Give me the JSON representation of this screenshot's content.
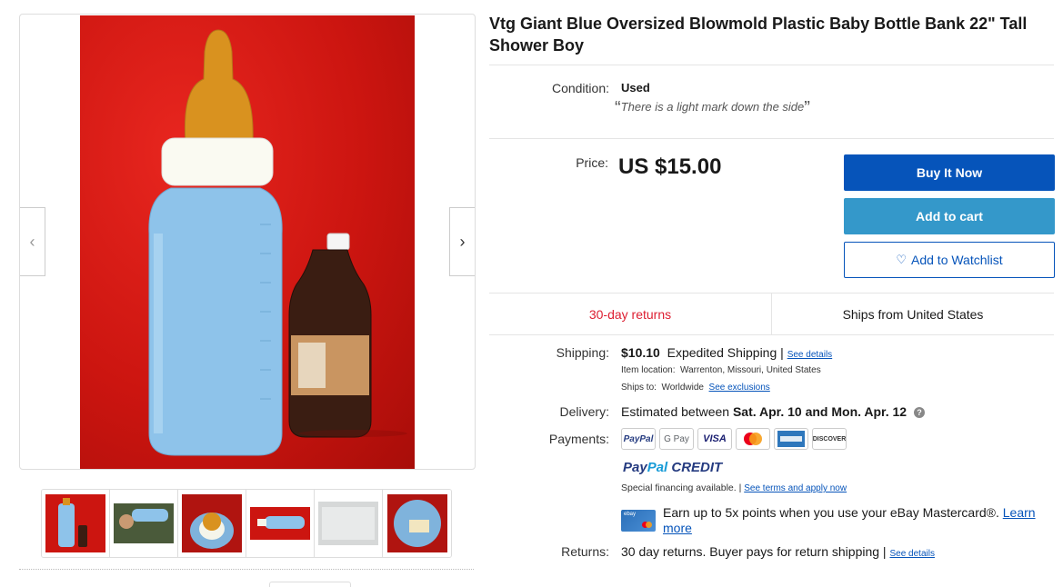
{
  "listing": {
    "title": "Vtg Giant Blue Oversized Blowmold Plastic Baby Bottle Bank 22\" Tall Shower Boy"
  },
  "condition": {
    "label": "Condition:",
    "value": "Used",
    "note": "There is a light mark down the side"
  },
  "price": {
    "label": "Price:",
    "value": "US $15.00"
  },
  "actions": {
    "buy_now": "Buy It Now",
    "add_to_cart": "Add to cart",
    "add_to_watchlist": "Add to Watchlist"
  },
  "badges": {
    "returns": "30-day returns",
    "ships_from": "Ships from United States"
  },
  "shipping": {
    "label": "Shipping:",
    "cost": "$10.10",
    "method": "Expedited Shipping |",
    "see_details": "See details",
    "location_label": "Item location:",
    "location": "Warrenton, Missouri, United States",
    "ships_to_label": "Ships to:",
    "ships_to": "Worldwide",
    "see_exclusions": "See exclusions"
  },
  "delivery": {
    "label": "Delivery:",
    "prefix": "Estimated between",
    "dates": "Sat. Apr. 10 and Mon. Apr. 12",
    "help_icon": "?"
  },
  "payments": {
    "label": "Payments:",
    "methods": [
      "PayPal",
      "G Pay",
      "VISA",
      "",
      "",
      "DISCOVER"
    ],
    "paypal_credit": {
      "p1": "Pay",
      "p2": "Pal",
      "p3": " CREDIT"
    },
    "financing": "Special financing available.  |",
    "financing_link": "See terms and apply now",
    "promo_text": "Earn up to 5x points when you use your eBay Mastercard®.",
    "promo_link": "Learn more",
    "card_label": "ebay"
  },
  "returns": {
    "label": "Returns:",
    "text": "30 day returns. Buyer pays for return shipping |",
    "see_details": "See details"
  },
  "gallery": {
    "prev_icon": "‹",
    "next_icon": "›"
  },
  "colors": {
    "primary_blue": "#0654ba",
    "cart_blue": "#3498ca",
    "returns_red": "#dd1e31",
    "photo_red": "#cc1510",
    "bottle_blue": "#8ec3ea"
  }
}
